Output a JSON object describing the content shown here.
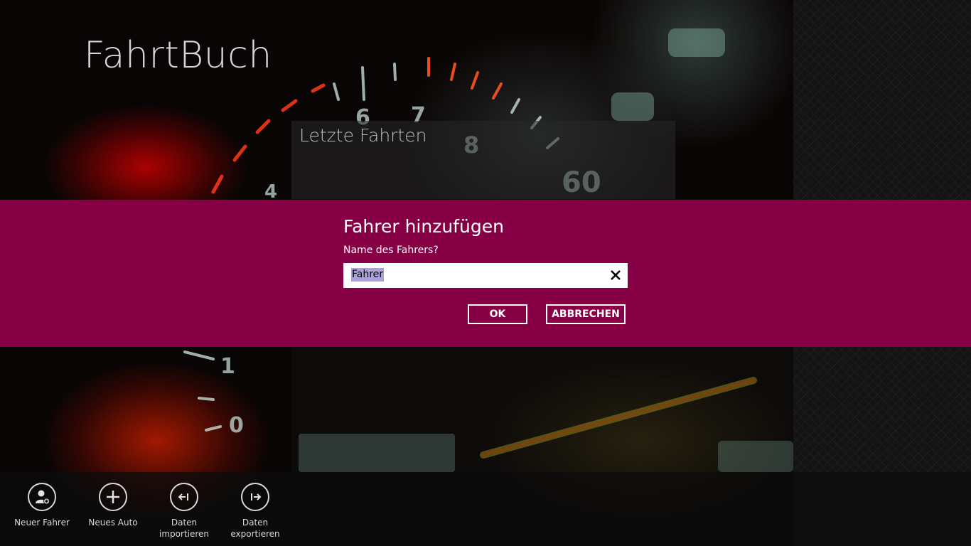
{
  "app": {
    "title": "FahrtBuch"
  },
  "section": {
    "title": "Letzte Fahrten"
  },
  "dialog": {
    "title": "Fahrer hinzufügen",
    "prompt": "Name des Fahrers?",
    "input_value": "Fahrer",
    "ok_label": "OK",
    "cancel_label": "ABBRECHEN",
    "background_color": "#870046"
  },
  "appbar": {
    "commands": [
      {
        "label": "Neuer Fahrer",
        "icon": "add-user-icon"
      },
      {
        "label": "Neues Auto",
        "icon": "plus-icon"
      },
      {
        "label_line1": "Daten",
        "label_line2": "importieren",
        "icon": "import-icon"
      },
      {
        "label_line1": "Daten",
        "label_line2": "exportieren",
        "icon": "export-icon"
      }
    ]
  }
}
